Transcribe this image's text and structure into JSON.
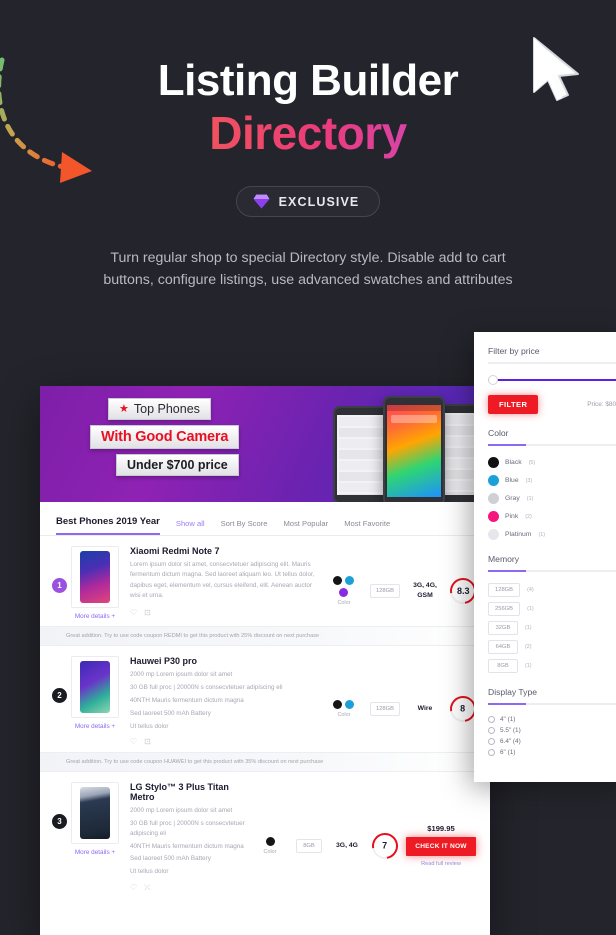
{
  "hero": {
    "title_line1": "Listing Builder",
    "title_line2": "Directory",
    "badge_label": "EXCLUSIVE",
    "badge_icon": "gem-icon",
    "subtitle": "Turn regular shop to special Directory style. Disable add to cart buttons, configure listings, use advanced swatches and attributes",
    "gradient_start": "#f7a13c",
    "gradient_end": "#9a5bf0"
  },
  "banner": {
    "tag1": "Top Phones",
    "tag2": "With Good Camera",
    "tag3": "Under $700 price",
    "accent_red": "#e81123"
  },
  "tabs": {
    "heading": "Best Phones 2019 Year",
    "items": [
      {
        "label": "Show all",
        "active": true
      },
      {
        "label": "Sort By Score",
        "active": false
      },
      {
        "label": "Most Popular",
        "active": false
      },
      {
        "label": "Most Favorite",
        "active": false
      }
    ]
  },
  "products": [
    {
      "rank": "1",
      "title": "Xiaomi Redmi Note 7",
      "desc": "Lorem ipsum dolor sit amet, consecvtetuer adipiscing elit. Mauris fermentum dictum magna. Sed laoreet aliquam leo. Ut tellus dolor, dapibus eget, elementum vel, cursus eleifend, elit. Aenean auctor wisi et urna.",
      "specs": [],
      "more_details": "More details +",
      "colors": [
        "#151515",
        "#1ba0d8",
        "#8a2be2"
      ],
      "color_label": "Color",
      "memory": "128GB",
      "network": "3G, 4G, GSM",
      "score": "8.3",
      "price": "",
      "cta": "",
      "read_full": ""
    },
    {
      "rank": "2",
      "title": "Hauwei P30 pro",
      "desc": "",
      "specs": [
        "2000 mp Lorem ipsum dolor sit amet",
        "30 GB full proc | 20000N s consecvtetuer adipiscing eli",
        "40NTH Mauris fermentum dictum magna",
        "Sed laoreet 500 mAh Battery",
        "Ut tellus dolor"
      ],
      "more_details": "More details +",
      "colors": [
        "#151515",
        "#1ba0d8"
      ],
      "color_label": "Color",
      "memory": "128GB",
      "network": "Wire",
      "score": "8",
      "price": "",
      "cta": "",
      "read_full": ""
    },
    {
      "rank": "3",
      "title": "LG Stylo™ 3 Plus Titan Metro",
      "desc": "",
      "specs": [
        "2000 mp Lorem ipsum dolor sit amet",
        "30 GB full proc | 20000N s consecvtetuer adipiscing eli",
        "40NTH Mauris fermentum dictum magna",
        "Sed laoreet 500 mAh Battery",
        "Ut tellus dolor"
      ],
      "more_details": "More details +",
      "colors": [
        "#151515"
      ],
      "color_label": "Color",
      "memory": "8GB",
      "network": "3G, 4G",
      "score": "7",
      "price": "$199.95",
      "cta": "CHECK IT NOW",
      "read_full": "Read full review"
    }
  ],
  "coupons": [
    "Great addition. Try to use code coupon REDMI to get this product with 25% discount on next purchase",
    "Great addition. Try to use code coupon HUAWEI to get this product with 35% discount on next purchase"
  ],
  "filter": {
    "price_title": "Filter by price",
    "filter_button": "FILTER",
    "price_value": "Price: $80",
    "color_title": "Color",
    "colors": [
      {
        "name": "Black",
        "count": "(5)",
        "hex": "#111111"
      },
      {
        "name": "Blue",
        "count": "(3)",
        "hex": "#1ba0d8"
      },
      {
        "name": "Gray",
        "count": "(1)",
        "hex": "#cfcfd6"
      },
      {
        "name": "Pink",
        "count": "(2)",
        "hex": "#f5167e"
      },
      {
        "name": "Platinum",
        "count": "(1)",
        "hex": "#e6e6ec"
      }
    ],
    "memory_title": "Memory",
    "memory": [
      {
        "label": "128GB",
        "count": "(4)"
      },
      {
        "label": "256GB",
        "count": "(1)"
      },
      {
        "label": "32GB",
        "count": "(1)"
      },
      {
        "label": "64GB",
        "count": "(2)"
      },
      {
        "label": "8GB",
        "count": "(1)"
      }
    ],
    "display_title": "Display Type",
    "display": [
      {
        "label": "4\" (1)"
      },
      {
        "label": "5.5\" (1)"
      },
      {
        "label": "6.4\" (4)"
      },
      {
        "label": "6\" (1)"
      }
    ]
  }
}
